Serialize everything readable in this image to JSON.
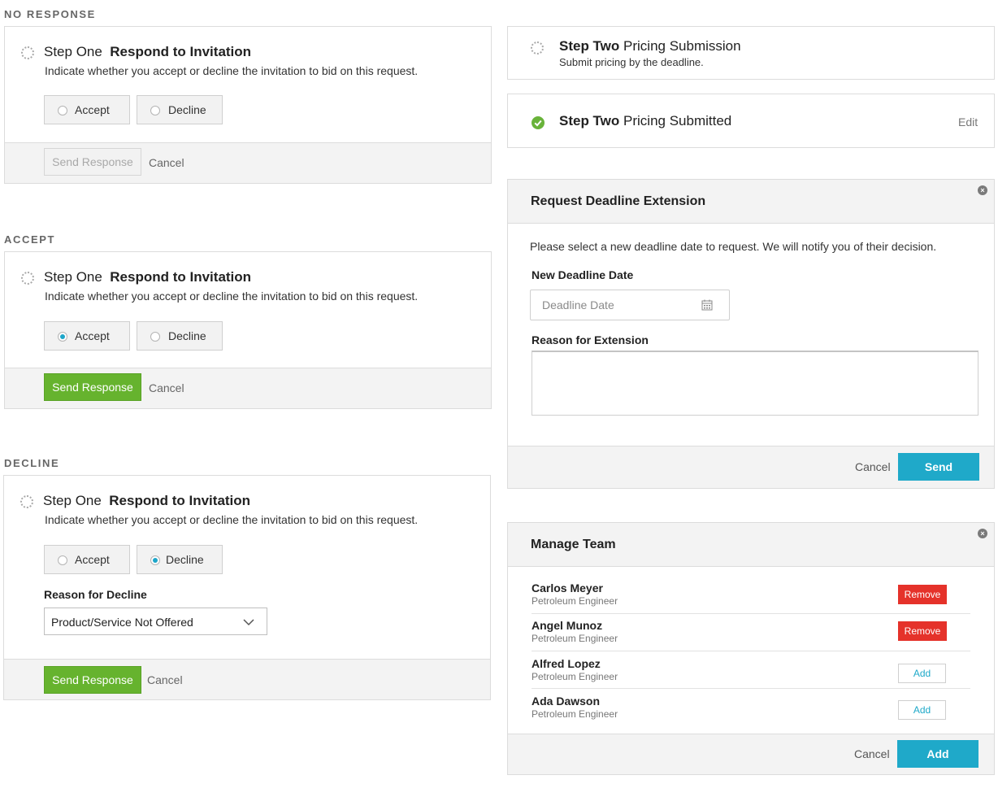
{
  "sections": {
    "no_response": "NO RESPONSE",
    "accept": "ACCEPT",
    "decline": "DECLINE"
  },
  "step_one": {
    "step_label": "Step One",
    "title": "Respond to Invitation",
    "description": "Indicate whether you accept or decline the invitation to bid on this request.",
    "accept_label": "Accept",
    "decline_label": "Decline",
    "send_label": "Send Response",
    "cancel_label": "Cancel"
  },
  "decline_form": {
    "reason_label": "Reason for Decline",
    "reason_value": "Product/Service Not Offered"
  },
  "step_two_pending": {
    "step_label": "Step Two",
    "title": "Pricing Submission",
    "description": "Submit pricing by the deadline."
  },
  "step_two_done": {
    "step_label": "Step Two",
    "title": "Pricing Submitted",
    "edit_label": "Edit"
  },
  "extension_modal": {
    "title": "Request Deadline Extension",
    "intro": "Please select a new deadline date to request. We will notify you of their decision.",
    "date_label": "New Deadline Date",
    "date_placeholder": "Deadline Date",
    "reason_label": "Reason for Extension",
    "cancel_label": "Cancel",
    "send_label": "Send"
  },
  "team_modal": {
    "title": "Manage Team",
    "members": [
      {
        "name": "Carlos Meyer",
        "role": "Petroleum Engineer",
        "action": "Remove"
      },
      {
        "name": "Angel Munoz",
        "role": "Petroleum Engineer",
        "action": "Remove"
      },
      {
        "name": "Alfred Lopez",
        "role": "Petroleum Engineer",
        "action": "Add"
      },
      {
        "name": "Ada Dawson",
        "role": "Petroleum Engineer",
        "action": "Add"
      }
    ],
    "cancel_label": "Cancel",
    "add_label": "Add"
  },
  "colors": {
    "green": "#66b32e",
    "blue": "#1fa9c9",
    "red": "#e5322a",
    "check_green": "#69b33a"
  },
  "icons": {
    "pending": "dotted-circle-icon",
    "complete": "check-circle-icon",
    "calendar": "calendar-icon",
    "close": "close-icon",
    "dropdown": "chevron-down-icon"
  }
}
